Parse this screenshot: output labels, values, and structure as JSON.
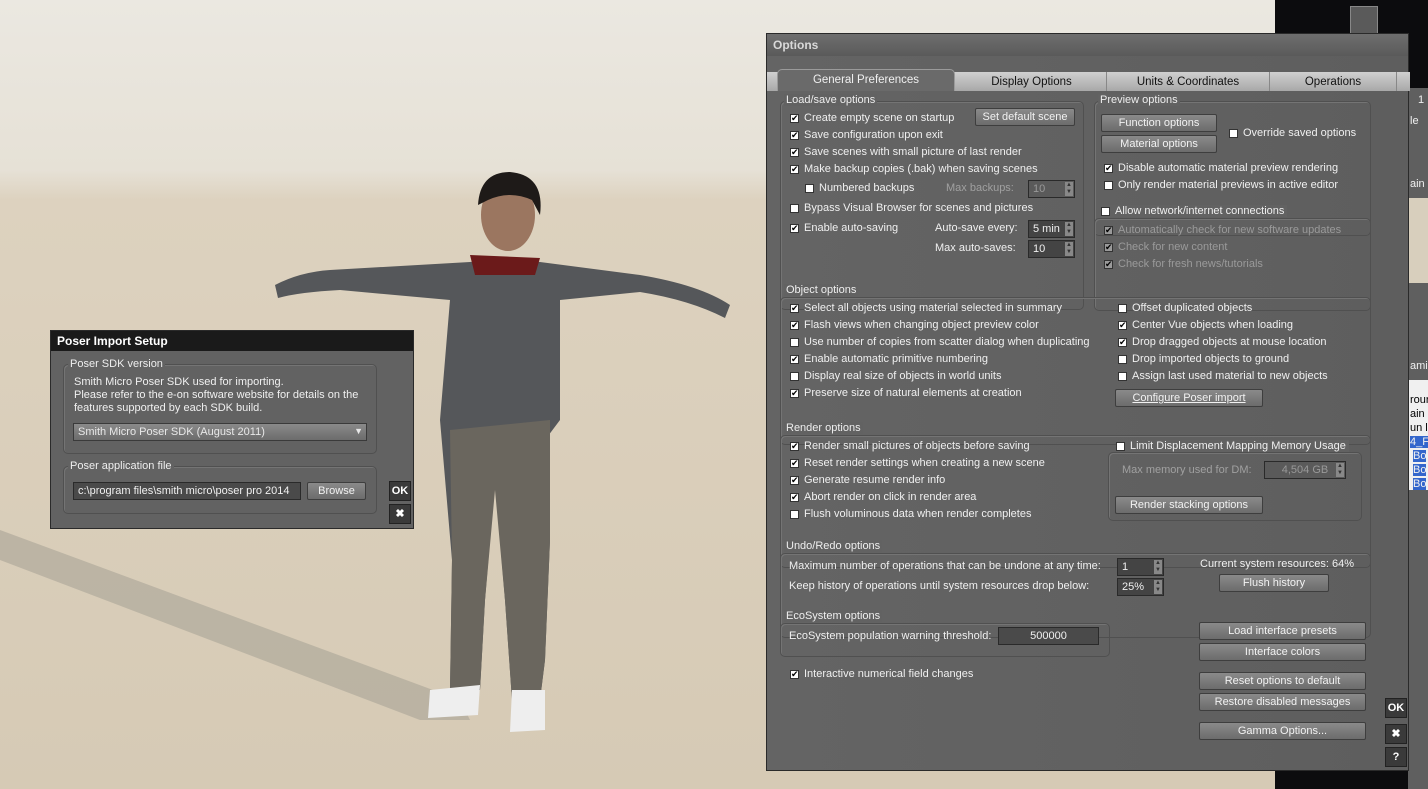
{
  "options": {
    "title": "Options",
    "tabs": [
      "General Preferences",
      "Display Options",
      "Units & Coordinates",
      "Operations"
    ],
    "load_save": {
      "legend": "Load/save options",
      "items": [
        {
          "label": "Create empty scene on startup",
          "checked": true
        },
        {
          "label": "Save configuration upon exit",
          "checked": true
        },
        {
          "label": "Save scenes with small picture of last render",
          "checked": true
        },
        {
          "label": "Make backup copies (.bak) when saving scenes",
          "checked": true
        },
        {
          "label": "Numbered backups",
          "checked": false
        },
        {
          "label": "Bypass Visual Browser for scenes and pictures",
          "checked": false
        },
        {
          "label": "Enable auto-saving",
          "checked": true
        }
      ],
      "set_default_scene": "Set default scene",
      "max_backups_label": "Max backups:",
      "max_backups": "10",
      "autosave_every_label": "Auto-save every:",
      "autosave_every": "5 min",
      "max_autosaves_label": "Max auto-saves:",
      "max_autosaves": "10"
    },
    "preview": {
      "legend": "Preview options",
      "function_options": "Function options",
      "material_options": "Material options",
      "items": [
        {
          "label": "Override saved options",
          "checked": false
        },
        {
          "label": "Disable automatic material preview rendering",
          "checked": true
        },
        {
          "label": "Only render material previews in active editor",
          "checked": false
        }
      ]
    },
    "network": {
      "label": "Allow network/internet connections",
      "checked": false,
      "items": [
        "Automatically check for new software updates",
        "Check for new content",
        "Check for fresh news/tutorials"
      ]
    },
    "object": {
      "legend": "Object options",
      "left": [
        {
          "label": "Select all objects using material selected in summary",
          "checked": true
        },
        {
          "label": "Flash views when changing object preview color",
          "checked": true
        },
        {
          "label": "Use number of copies from scatter dialog when duplicating",
          "checked": false
        },
        {
          "label": "Enable automatic primitive numbering",
          "checked": true
        },
        {
          "label": "Display real size of objects in world units",
          "checked": false
        },
        {
          "label": "Preserve size of natural elements at creation",
          "checked": true
        }
      ],
      "right": [
        {
          "label": "Offset duplicated objects",
          "checked": false
        },
        {
          "label": "Center Vue objects when loading",
          "checked": true
        },
        {
          "label": "Drop dragged objects at mouse location",
          "checked": true
        },
        {
          "label": "Drop imported objects to ground",
          "checked": false
        },
        {
          "label": "Assign last used material to new objects",
          "checked": false
        }
      ],
      "configure_poser": "Configure Poser import"
    },
    "render": {
      "legend": "Render options",
      "items": [
        {
          "label": "Render small pictures of objects before saving",
          "checked": true
        },
        {
          "label": "Reset render settings when creating a new scene",
          "checked": true
        },
        {
          "label": "Generate resume render info",
          "checked": true
        },
        {
          "label": "Abort render on click in render area",
          "checked": true
        },
        {
          "label": "Flush voluminous data when render completes",
          "checked": false
        }
      ],
      "limit_dm": {
        "label": "Limit Displacement Mapping Memory Usage",
        "checked": false
      },
      "max_memory_label": "Max memory used for DM:",
      "max_memory": "4,504 GB",
      "stacking": "Render stacking options"
    },
    "undo": {
      "legend": "Undo/Redo options",
      "max_ops_label": "Maximum number of operations that can be undone at any time:",
      "max_ops": "1",
      "keep_label": "Keep history of operations until system resources drop below:",
      "keep": "25%",
      "resources": "Current system resources: 64%",
      "flush": "Flush history"
    },
    "eco": {
      "legend": "EcoSystem options",
      "label": "EcoSystem population warning threshold:",
      "value": "500000"
    },
    "interactive": {
      "label": "Interactive numerical field changes",
      "checked": true
    },
    "buttons": {
      "load_presets": "Load interface presets",
      "colors": "Interface colors",
      "reset": "Reset options to default",
      "restore": "Restore disabled messages",
      "gamma": "Gamma Options..."
    },
    "ok": "OK",
    "close": "✖",
    "help": "?"
  },
  "poser": {
    "title": "Poser Import Setup",
    "sdk_legend": "Poser SDK version",
    "sdk_text": [
      "Smith Micro Poser SDK used for importing.",
      "Please refer to the e-on software website for details on the",
      "features supported by each SDK build."
    ],
    "sdk_selected": "Smith Micro Poser SDK (August 2011)",
    "file_legend": "Poser application file",
    "file_path": "c:\\program files\\smith micro\\poser pro 2014",
    "browse": "Browse",
    "ok": "OK",
    "close": "✖"
  },
  "bg_fragments": [
    "1",
    "le",
    "ain",
    "amic",
    "rour",
    "ain",
    "un li",
    "4_F",
    "Bo",
    "Bo",
    "Bo"
  ]
}
